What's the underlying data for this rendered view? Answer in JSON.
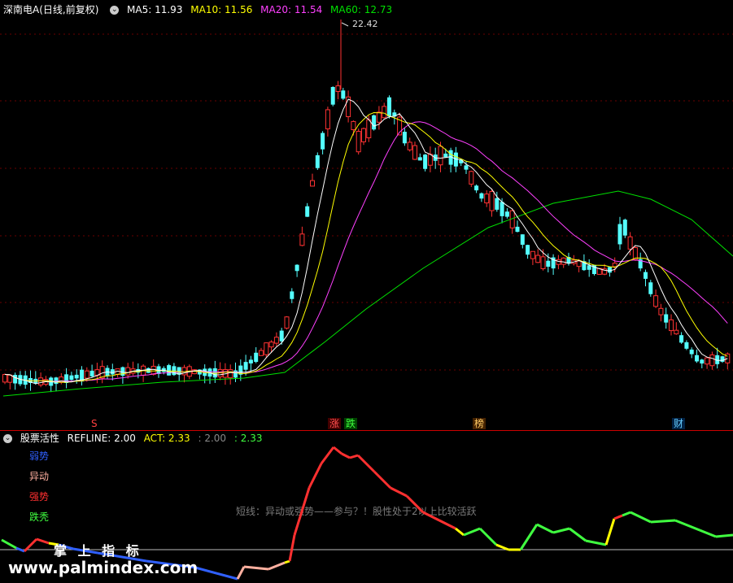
{
  "main_header": {
    "stock": "深南电A(日线,前复权)",
    "ma5": "MA5: 11.93",
    "ma10": "MA10: 11.56",
    "ma20": "MA20: 11.54",
    "ma60": "MA60: 12.73"
  },
  "peak_label": "22.42",
  "markers": {
    "s": "S",
    "zhang": "涨",
    "die": "跌",
    "bang": "榜",
    "cai": "财"
  },
  "ind_header": {
    "name": "股票活性",
    "refline": "REFLINE: 2.00",
    "act": "ACT: 2.33",
    "v1": ": 2.00",
    "v2": ": 2.33"
  },
  "legend": {
    "weak": "弱势",
    "abnormal": "异动",
    "strong": "强势",
    "bald": "跌秃"
  },
  "note": "短线：异动或强势——参与？！股性处于2以上比较活跃",
  "watermark": {
    "cn": "掌 上 指 标",
    "url": "www.palmindex.com"
  },
  "colors": {
    "up": "#ff3232",
    "down": "#54ffff",
    "ma5": "#ffffff",
    "ma10": "#ffff00",
    "ma20": "#ff40ff",
    "ma60": "#00e000",
    "separator": "#cc0000"
  }
}
